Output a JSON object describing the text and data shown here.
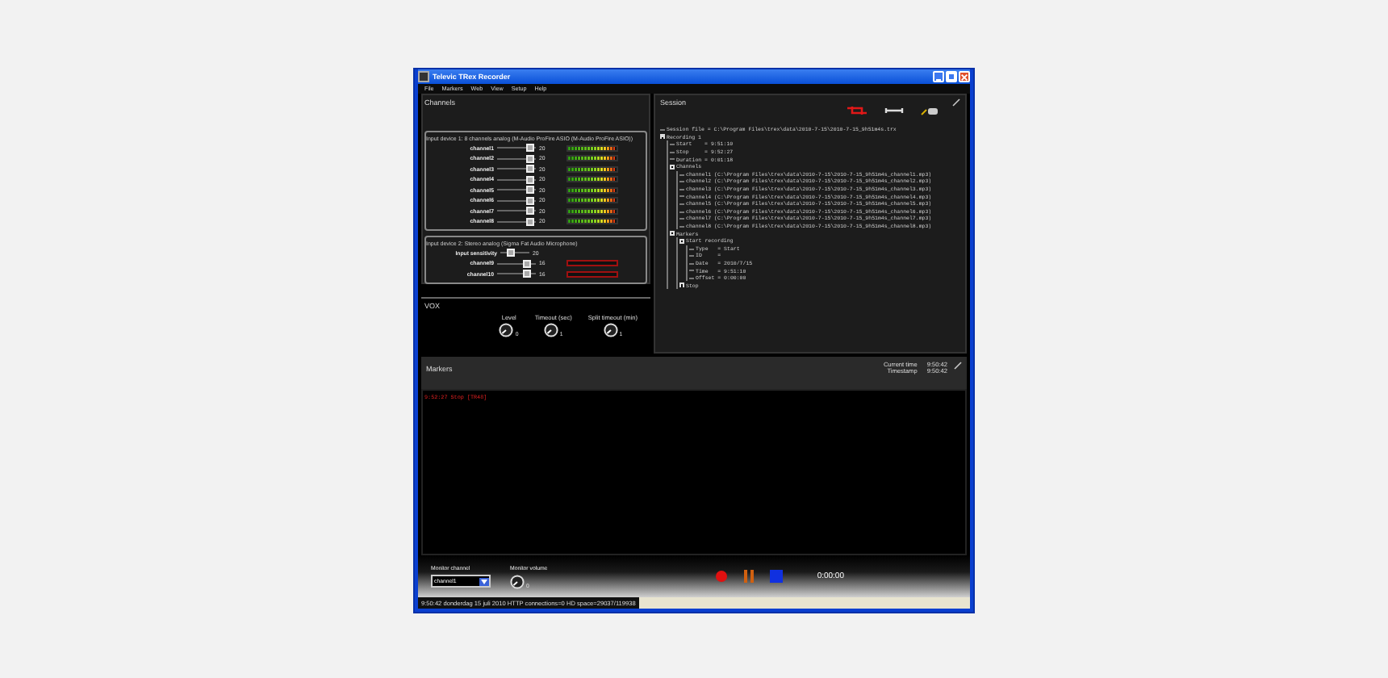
{
  "window": {
    "title": "Televic TRex Recorder"
  },
  "menu": [
    "File",
    "Markers",
    "Web",
    "View",
    "Setup",
    "Help"
  ],
  "channels_panel": {
    "title": "Channels",
    "devices": [
      {
        "title": "Input device 1: 8 channels analog (M-Audio ProFire ASIO (M-Audio ProFire ASIO))",
        "channels": [
          {
            "name": "channel1",
            "level": 0.85,
            "value": "20",
            "meter": {
              "level": 0.95
            }
          },
          {
            "name": "channel2",
            "level": 0.85,
            "value": "20",
            "meter": {
              "level": 0.95
            }
          },
          {
            "name": "channel3",
            "level": 0.85,
            "value": "20",
            "meter": {
              "level": 0.95
            }
          },
          {
            "name": "channel4",
            "level": 0.85,
            "value": "20",
            "meter": {
              "level": 0.95
            }
          },
          {
            "name": "channel5",
            "level": 0.85,
            "value": "20",
            "meter": {
              "level": 0.95
            }
          },
          {
            "name": "channel6",
            "level": 0.85,
            "value": "20",
            "meter": {
              "level": 0.95
            }
          },
          {
            "name": "channel7",
            "level": 0.85,
            "value": "20",
            "meter": {
              "level": 0.95
            }
          },
          {
            "name": "channel8",
            "level": 0.85,
            "value": "20",
            "meter": {
              "level": 0.95
            }
          }
        ]
      },
      {
        "title": "Input device 2: Stereo analog (Sigma Fat Audio Microphone)",
        "sensitivity": {
          "label": "Input sensitivity",
          "level": 0.35,
          "value": "20"
        },
        "channels": [
          {
            "name": "channel9",
            "level": 0.75,
            "value": "16",
            "meter": {
              "level": 0
            }
          },
          {
            "name": "channel10",
            "level": 0.75,
            "value": "16",
            "meter": {
              "level": 0
            }
          }
        ]
      }
    ]
  },
  "vox": {
    "title": "VOX",
    "knobs": [
      {
        "label": "Level",
        "value": "0"
      },
      {
        "label": "Timeout (sec)",
        "value": "1"
      },
      {
        "label": "Split timeout (min)",
        "value": "1"
      }
    ]
  },
  "session": {
    "title": "Session",
    "tree": [
      {
        "label": "Session file = C:\\Program Files\\trex\\data\\2010-7-15\\2010-7-15_9h51m4s.trx"
      },
      {
        "label": "Recording 1",
        "expanded": true,
        "children": [
          {
            "label": "Start    = 9:51:10"
          },
          {
            "label": "Stop     = 9:52:27"
          },
          {
            "label": "Duration = 0:01:18"
          },
          {
            "label": "Channels",
            "expanded": true,
            "children": [
              {
                "label": "channel1 (C:\\Program Files\\trex\\data\\2010-7-15\\2010-7-15_9h51m4s_channel1.mp3)"
              },
              {
                "label": "channel2 (C:\\Program Files\\trex\\data\\2010-7-15\\2010-7-15_9h51m4s_channel2.mp3)"
              },
              {
                "label": "channel3 (C:\\Program Files\\trex\\data\\2010-7-15\\2010-7-15_9h51m4s_channel3.mp3)"
              },
              {
                "label": "channel4 (C:\\Program Files\\trex\\data\\2010-7-15\\2010-7-15_9h51m4s_channel4.mp3)"
              },
              {
                "label": "channel5 (C:\\Program Files\\trex\\data\\2010-7-15\\2010-7-15_9h51m4s_channel5.mp3)"
              },
              {
                "label": "channel6 (C:\\Program Files\\trex\\data\\2010-7-15\\2010-7-15_9h51m4s_channel6.mp3)"
              },
              {
                "label": "channel7 (C:\\Program Files\\trex\\data\\2010-7-15\\2010-7-15_9h51m4s_channel7.mp3)"
              },
              {
                "label": "channel8 (C:\\Program Files\\trex\\data\\2010-7-15\\2010-7-15_9h51m4s_channel8.mp3)"
              }
            ]
          },
          {
            "label": "Markers",
            "expanded": true,
            "children": [
              {
                "label": "Start recording",
                "expanded": true,
                "children": [
                  {
                    "label": "Type   = Start"
                  },
                  {
                    "label": "ID     ="
                  },
                  {
                    "label": "Date   = 2010/7/15"
                  },
                  {
                    "label": "Time   = 9:51:10"
                  },
                  {
                    "label": "Offset = 0:00:00"
                  }
                ]
              },
              {
                "label": "Stop",
                "expanded": false
              }
            ]
          }
        ]
      }
    ]
  },
  "markers": {
    "title": "Markers",
    "current_time": {
      "label": "Current time",
      "value": "9:50:42"
    },
    "timestamp": {
      "label": "Timestamp",
      "value": "9:50:42"
    },
    "entries": [
      "9:52:27 Stop [TR48]"
    ]
  },
  "controls": {
    "monitor_channel": {
      "label": "Monitor channel",
      "value": "channel1"
    },
    "monitor_volume": {
      "label": "Monitor volume",
      "value": "0"
    },
    "time": "0:00:00"
  },
  "status_bar": "9:50:42  donderdag 15 juli 2010   HTTP connections=0   HD space=29037/119938"
}
